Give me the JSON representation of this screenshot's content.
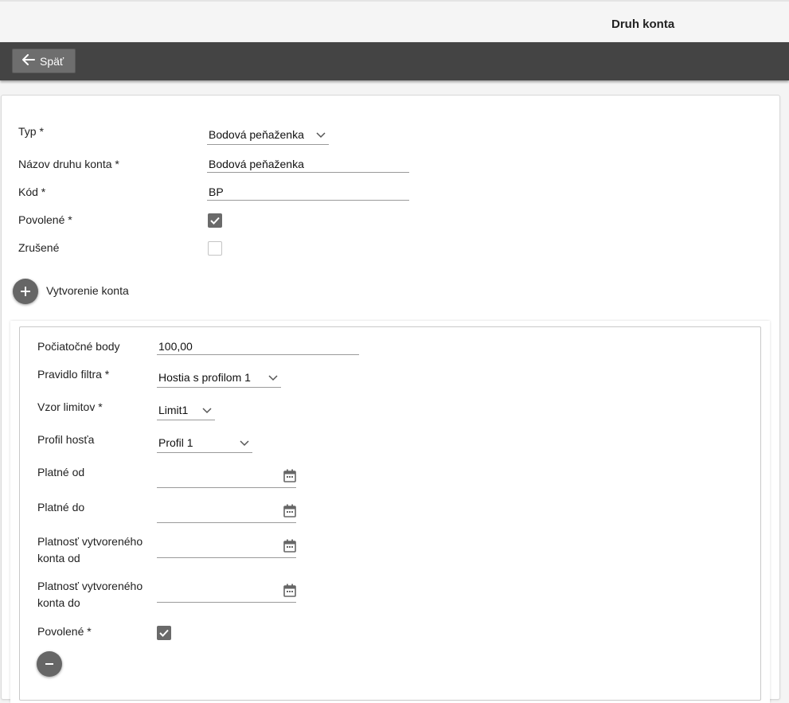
{
  "header": {
    "title": "Druh konta"
  },
  "toolbar": {
    "back_label": "Späť",
    "back_icon": "arrow-left-icon"
  },
  "form": {
    "typ": {
      "label": "Typ *",
      "value": "Bodová peňaženka"
    },
    "nazov": {
      "label": "Názov druhu konta *",
      "value": "Bodová peňaženka"
    },
    "kod": {
      "label": "Kód *",
      "value": "BP"
    },
    "povolene": {
      "label": "Povolené *",
      "checked": true
    },
    "zrusene": {
      "label": "Zrušené",
      "checked": false
    },
    "add_account": {
      "label": "Vytvorenie konta",
      "icon": "plus-icon"
    }
  },
  "account": {
    "pociatocne_body": {
      "label": "Počiatočné body",
      "value": "100,00"
    },
    "pravidlo_filtra": {
      "label": "Pravidlo filtra *",
      "value": "Hostia s profilom 1"
    },
    "vzor_limitov": {
      "label": "Vzor limitov *",
      "value": "Limit1"
    },
    "profil_hosta": {
      "label": "Profil hosťa",
      "value": "Profil 1"
    },
    "platne_od": {
      "label": "Platné od",
      "value": ""
    },
    "platne_do": {
      "label": "Platné do",
      "value": ""
    },
    "platnost_od": {
      "label": "Platnosť vytvoreného konta od",
      "value": ""
    },
    "platnost_do": {
      "label": "Platnosť vytvoreného konta do",
      "value": ""
    },
    "povolene": {
      "label": "Povolené *",
      "checked": true
    },
    "remove_icon": "minus-icon"
  },
  "colors": {
    "toolbar": "#444444",
    "button": "#6e6e6e",
    "checkbox": "#6a6a6a"
  }
}
